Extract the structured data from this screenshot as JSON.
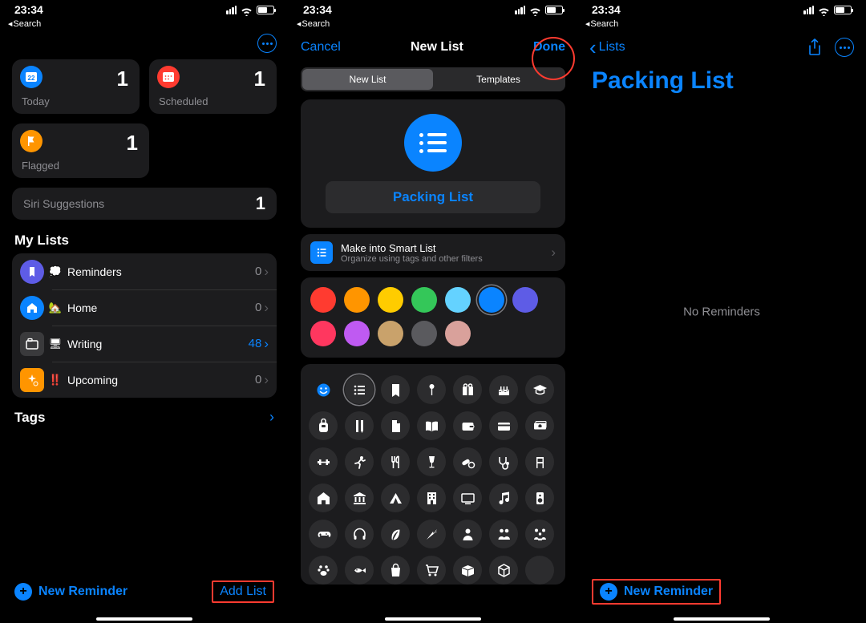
{
  "status": {
    "time": "23:34"
  },
  "back_search": "Search",
  "s1": {
    "today": {
      "label": "Today",
      "count": "1"
    },
    "scheduled": {
      "label": "Scheduled",
      "count": "1"
    },
    "flagged": {
      "label": "Flagged",
      "count": "1"
    },
    "siri": {
      "label": "Siri Suggestions",
      "count": "1"
    },
    "mylists_header": "My Lists",
    "lists": [
      {
        "emoji": "💭",
        "name": "Reminders",
        "count": "0"
      },
      {
        "emoji": "🏡",
        "name": "Home",
        "count": "0"
      },
      {
        "emoji": "🖥",
        "name": "Writing",
        "count": "48"
      },
      {
        "emoji": "‼️",
        "name": "Upcoming",
        "count": "0"
      }
    ],
    "tags": "Tags",
    "new_reminder": "New Reminder",
    "add_list": "Add List"
  },
  "s2": {
    "cancel": "Cancel",
    "title": "New List",
    "done": "Done",
    "seg": {
      "newlist": "New List",
      "templates": "Templates"
    },
    "list_name": "Packing List",
    "smart_title": "Make into Smart List",
    "smart_sub": "Organize using tags and other filters",
    "colors_row1": [
      "#ff3b30",
      "#ff9500",
      "#ffcc00",
      "#34c759",
      "#64d2ff",
      "#0a84ff",
      "#5e5ce6"
    ],
    "colors_row2": [
      "#ff375f",
      "#bf5af2",
      "#c9a26b",
      "#5a5a5e",
      "#d9a19b"
    ],
    "selected_color_index": 5
  },
  "s3": {
    "back": "Lists",
    "title": "Packing List",
    "empty": "No Reminders",
    "new_reminder": "New Reminder"
  }
}
